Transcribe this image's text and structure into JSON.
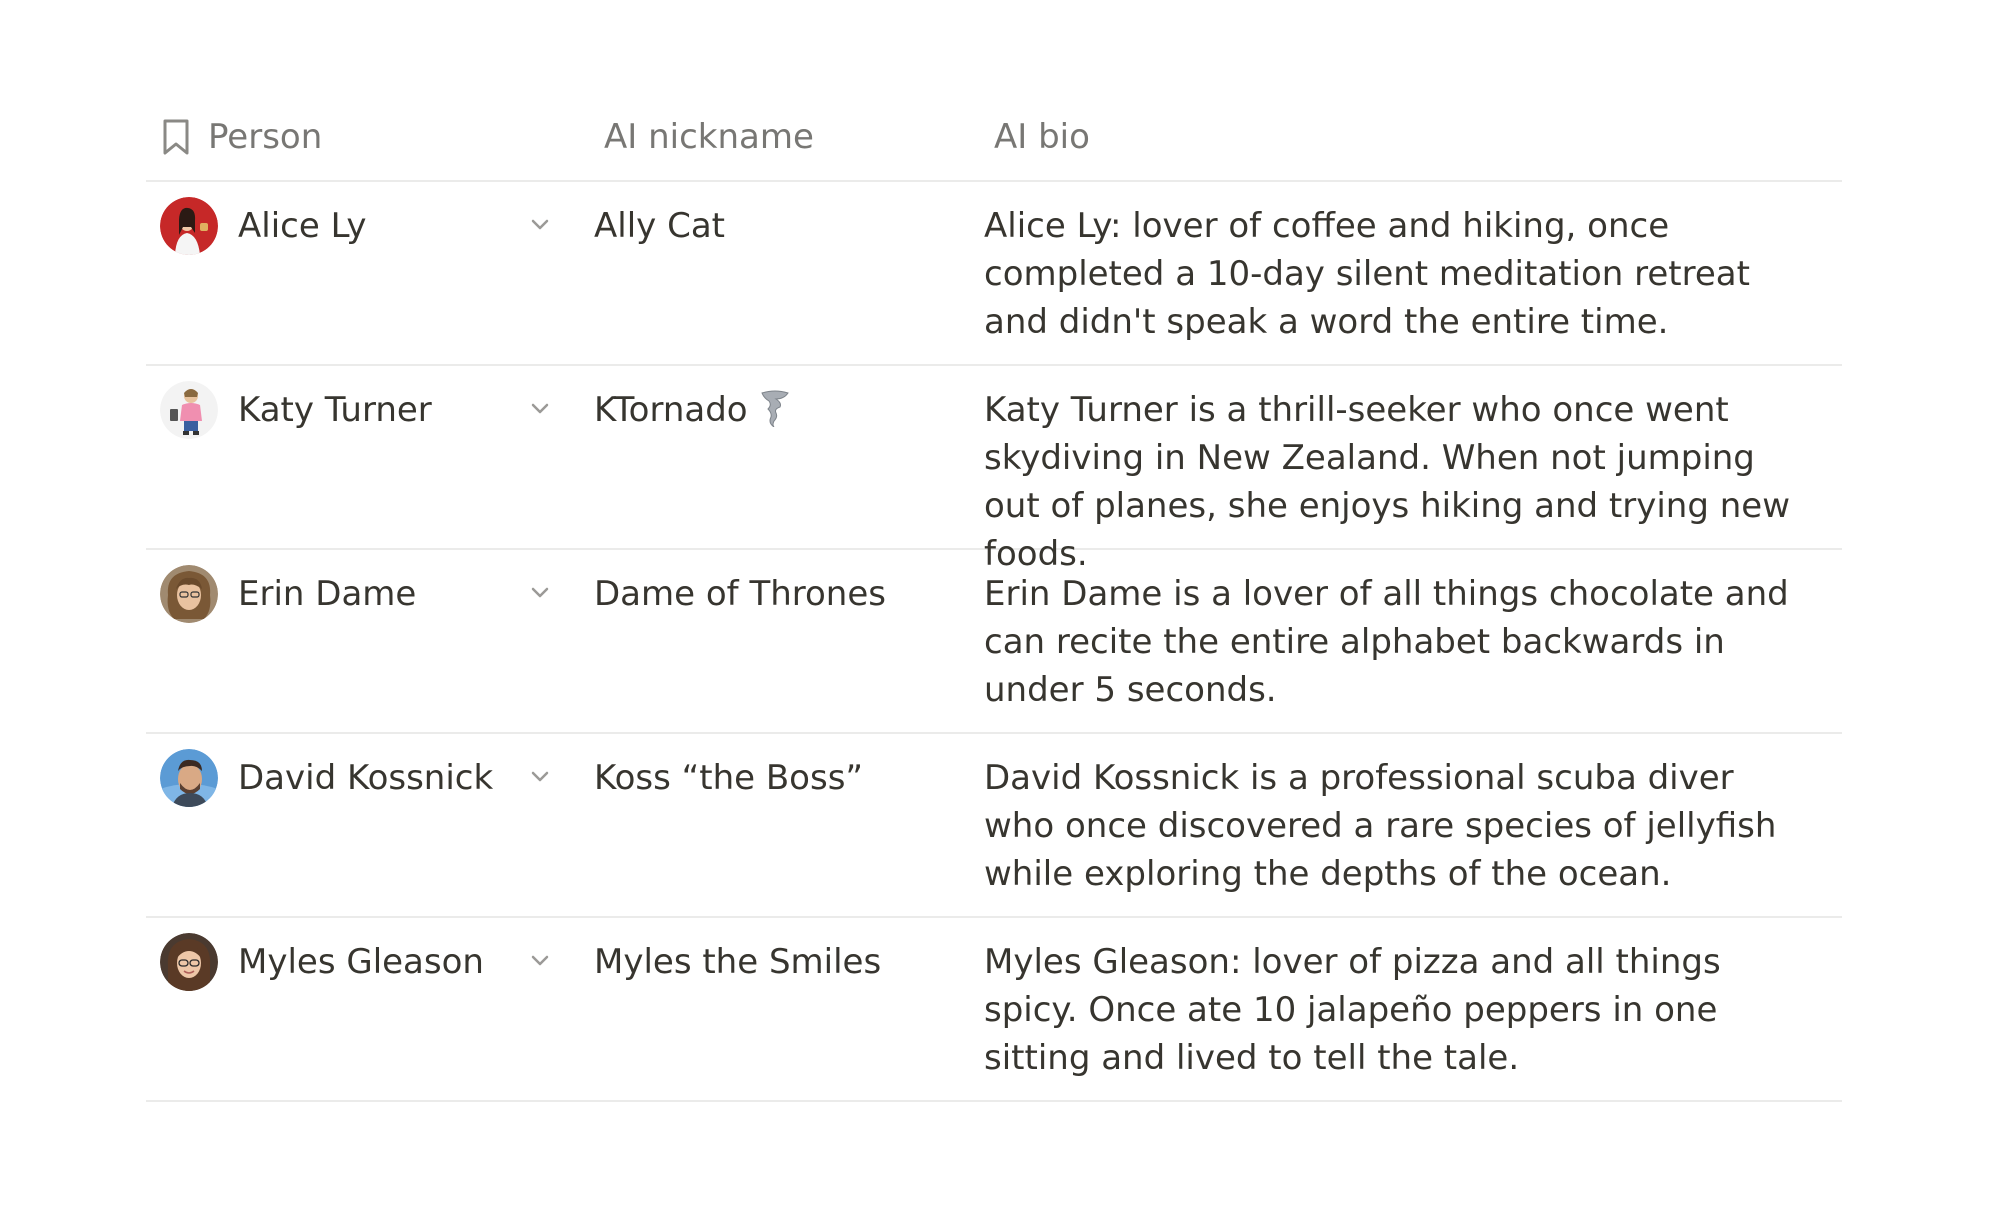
{
  "columns": {
    "person": "Person",
    "nickname": "AI nickname",
    "bio": "AI bio"
  },
  "rows": [
    {
      "name": "Alice Ly",
      "nickname": "Ally Cat",
      "bio": "Alice Ly: lover of coffee and hiking, once completed a 10-day silent meditation retreat and didn't speak a word the entire time.",
      "avatar_color": "#c62828"
    },
    {
      "name": "Katy Turner",
      "nickname": "KTornado",
      "nickname_emoji": "tornado-icon",
      "bio": "Katy Turner is a thrill-seeker who once went skydiving in New Zealand. When not jumping out of planes, she enjoys hiking and trying new foods.",
      "avatar_color": "#f3f3f3"
    },
    {
      "name": "Erin Dame",
      "nickname": "Dame of Thrones",
      "bio": "Erin Dame is a lover of all things chocolate and can recite the entire alphabet backwards in under 5 seconds.",
      "avatar_color": "#8a6a4a"
    },
    {
      "name": "David Kossnick",
      "nickname": "Koss “the Boss”",
      "bio": "David Kossnick is a professional scuba diver who once discovered a rare species of jellyfish while exploring the depths of the ocean.",
      "avatar_color": "#5b9bd5"
    },
    {
      "name": "Myles Gleason",
      "nickname": "Myles the Smiles",
      "bio": "Myles Gleason: lover of pizza and all things spicy. Once ate 10 jalapeño peppers in one sitting and lived to tell the tale.",
      "avatar_color": "#6d4c3d"
    }
  ]
}
